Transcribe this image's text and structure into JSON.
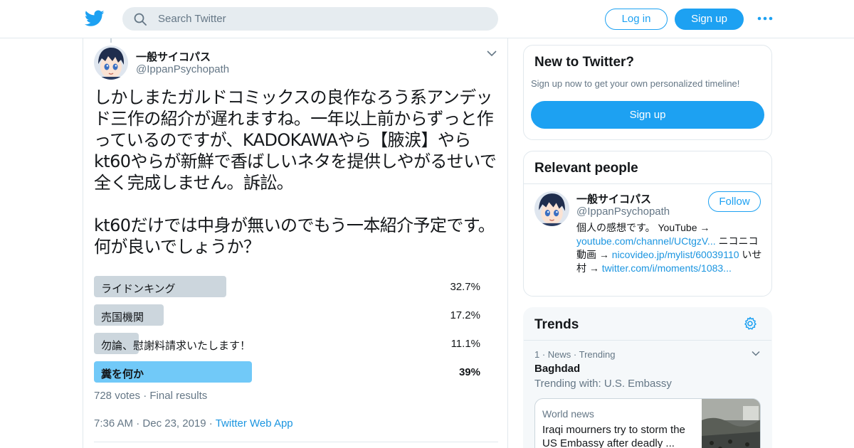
{
  "header": {
    "search_placeholder": "Search Twitter",
    "login_label": "Log in",
    "signup_label": "Sign up",
    "more_icon": "more-dots-icon"
  },
  "tweet": {
    "author_name": "一般サイコパス",
    "author_handle": "@IppanPsychopath",
    "text": "しかしまたガルドコミックスの良作なろう系アンデッド三作の紹介が遅れますね。一年以上前からずっと作っているのですが、KADOKAWAやら【腋涙】やらkt60やらが新鮮で香ばしいネタを提供しやがるせいで全く完成しません。訴訟。\n\nkt60だけでは中身が無いのでもう一本紹介予定です。何が良いでしょうか？",
    "poll": [
      {
        "label": "ライドンキング",
        "percent": "32.7%",
        "fraction": 0.327,
        "winner": false
      },
      {
        "label": "売国機関",
        "percent": "17.2%",
        "fraction": 0.172,
        "winner": false
      },
      {
        "label": "勿論、慰謝料請求いたします！",
        "percent": "11.1%",
        "fraction": 0.111,
        "winner": false
      },
      {
        "label": "糞を何か",
        "percent": "39%",
        "fraction": 0.39,
        "winner": true
      }
    ],
    "votes": "728 votes",
    "poll_status": "Final results",
    "time": "7:36 AM",
    "date": "Dec 23, 2019",
    "source": "Twitter Web App"
  },
  "new_to_twitter": {
    "title": "New to Twitter?",
    "subtitle": "Sign up now to get your own personalized timeline!",
    "button": "Sign up"
  },
  "relevant_people": {
    "title": "Relevant people",
    "name": "一般サイコパス",
    "handle": "@IppanPsychopath",
    "follow_label": "Follow",
    "bio_1": "個人の感想です。 YouTube → ",
    "bio_link_1": "youtube.com/channel/UCtgzV...",
    "bio_2": " ニコニコ動画 → ",
    "bio_link_2": "nicovideo.jp/mylist/60039110",
    "bio_3": " いせ村 → ",
    "bio_link_3": "twitter.com/i/moments/1083..."
  },
  "trends": {
    "title": "Trends",
    "item_rank": "1",
    "item_category": "News",
    "item_status": "Trending",
    "item_name": "Baghdad",
    "item_with": "Trending with: U.S. Embassy",
    "news_category": "World news",
    "news_headline": "Iraqi mourners try to storm the US Embassy after deadly ..."
  },
  "colors": {
    "brand": "#1da1f2",
    "poll_winner": "#71c9f8",
    "poll_bar": "#ccd6dd"
  }
}
